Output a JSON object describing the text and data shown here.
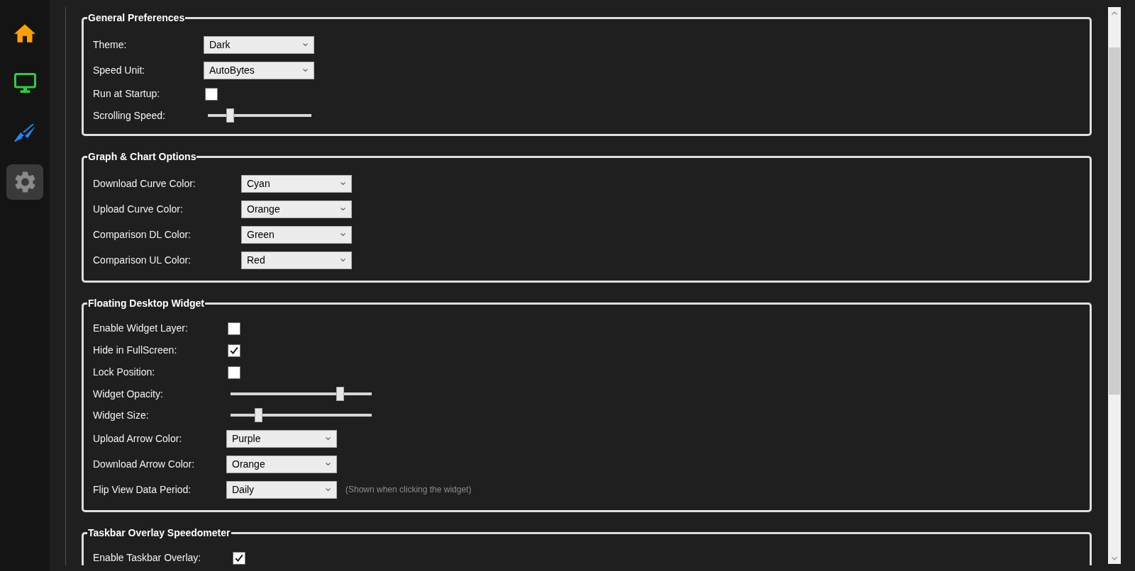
{
  "sidebar": {
    "items": [
      {
        "kind": "home",
        "selected": false
      },
      {
        "kind": "monitor",
        "selected": false
      },
      {
        "kind": "chart",
        "selected": false
      },
      {
        "kind": "settings",
        "selected": true
      }
    ]
  },
  "groups": [
    {
      "title": "General Preferences",
      "rows": [
        {
          "kind": "dropdown",
          "label": "Theme:",
          "value": "Dark"
        },
        {
          "kind": "dropdown",
          "label": "Speed Unit:",
          "value": "AutoBytes"
        },
        {
          "kind": "checkbox",
          "label": "Run at Startup:",
          "checked": false
        },
        {
          "kind": "slider",
          "label": "Scrolling Speed:",
          "level": 0.19
        }
      ]
    },
    {
      "title": "Graph & Chart Options",
      "rows": [
        {
          "kind": "dropdown",
          "label": "Download Curve Color:",
          "value": "Cyan"
        },
        {
          "kind": "dropdown",
          "label": "Upload Curve Color:",
          "value": "Orange"
        },
        {
          "kind": "dropdown",
          "label": "Comparison DL Color:",
          "value": "Green"
        },
        {
          "kind": "dropdown",
          "label": "Comparison UL Color:",
          "value": "Red"
        }
      ]
    },
    {
      "title": "Floating Desktop Widget",
      "rows": [
        {
          "kind": "checkbox",
          "label": "Enable Widget Layer:",
          "checked": false
        },
        {
          "kind": "checkbox",
          "label": "Hide in FullScreen:",
          "checked": true
        },
        {
          "kind": "checkbox",
          "label": "Lock Position:",
          "checked": false
        },
        {
          "kind": "slider",
          "label": "Widget Opacity:",
          "level": 0.79
        },
        {
          "kind": "slider",
          "label": "Widget Size:",
          "level": 0.18
        },
        {
          "kind": "dropdown",
          "label": "Upload Arrow Color:",
          "value": "Purple"
        },
        {
          "kind": "dropdown",
          "label": "Download Arrow Color:",
          "value": "Orange"
        },
        {
          "kind": "dropdown",
          "label": "Flip View Data Period:",
          "value": "Daily",
          "note": "(Shown when clicking the widget)"
        }
      ]
    },
    {
      "title": "Taskbar Overlay Speedometer",
      "rows": [
        {
          "kind": "checkbox",
          "label": "Enable Taskbar Overlay:",
          "checked": true
        }
      ]
    }
  ]
}
